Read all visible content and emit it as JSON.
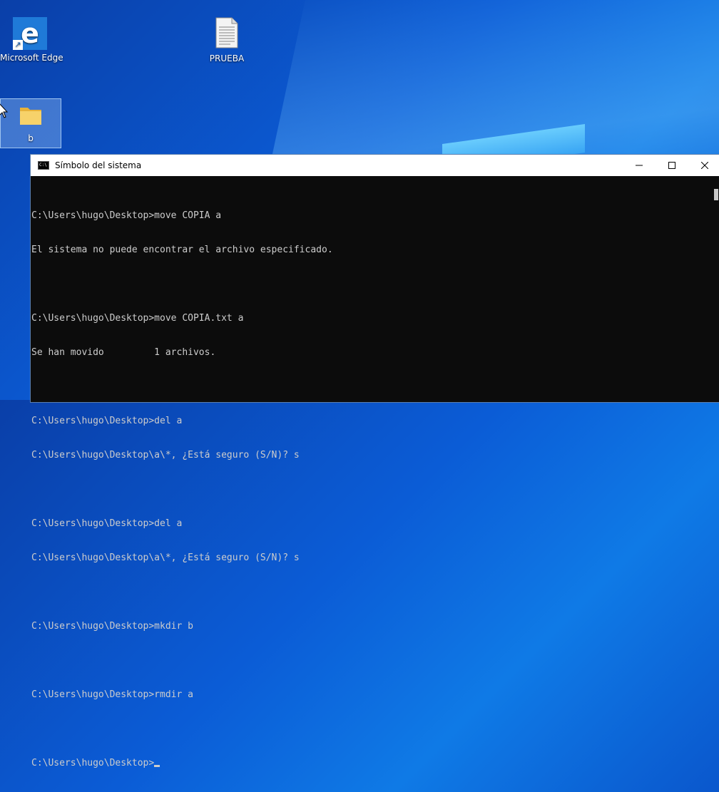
{
  "desktop": {
    "icons": [
      {
        "label": "Microsoft Edge",
        "icon": "edge-icon"
      },
      {
        "label": "PRUEBA",
        "icon": "text-document-icon"
      },
      {
        "label": "b",
        "icon": "folder-icon"
      }
    ]
  },
  "window": {
    "title": "Símbolo del sistema",
    "icon": "cmd-icon",
    "controls": [
      "minimize",
      "maximize",
      "close"
    ]
  },
  "console": {
    "lines": [
      "C:\\Users\\hugo\\Desktop>move COPIA a",
      "El sistema no puede encontrar el archivo especificado.",
      "",
      "C:\\Users\\hugo\\Desktop>move COPIA.txt a",
      "Se han movido         1 archivos.",
      "",
      "C:\\Users\\hugo\\Desktop>del a",
      "C:\\Users\\hugo\\Desktop\\a\\*, ¿Está seguro (S/N)? s",
      "",
      "C:\\Users\\hugo\\Desktop>del a",
      "C:\\Users\\hugo\\Desktop\\a\\*, ¿Está seguro (S/N)? s",
      "",
      "C:\\Users\\hugo\\Desktop>mkdir b",
      "",
      "C:\\Users\\hugo\\Desktop>rmdir a",
      "",
      "C:\\Users\\hugo\\Desktop>"
    ]
  }
}
